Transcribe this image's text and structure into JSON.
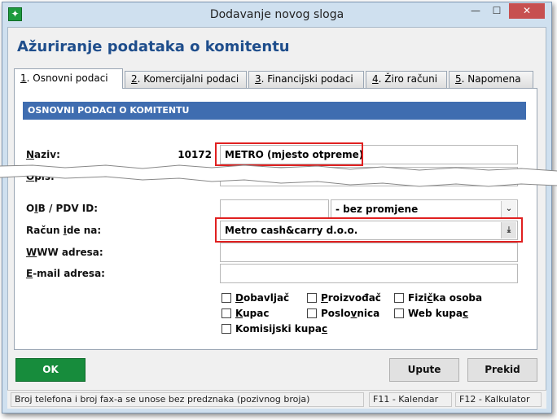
{
  "window": {
    "title": "Dodavanje novog sloga",
    "icon": "app-star-icon",
    "minimize_label": "—",
    "maximize_label": "☐",
    "close_label": "✕"
  },
  "dialog": {
    "heading": "Ažuriranje podataka o komitentu"
  },
  "tabs": [
    {
      "num": "1",
      "label": ". Osnovni podaci"
    },
    {
      "num": "2",
      "label": ". Komercijalni podaci"
    },
    {
      "num": "3",
      "label": ". Financijski podaci"
    },
    {
      "num": "4",
      "label": ". Žiro računi"
    },
    {
      "num": "5",
      "label": ". Napomena"
    }
  ],
  "section": {
    "title": "OSNOVNI PODACI O KOMITENTU"
  },
  "form": {
    "naziv": {
      "label_u": "N",
      "label_rest": "aziv:",
      "code": "10172",
      "value": "METRO (mjesto otpreme)"
    },
    "opis": {
      "label_u": "O",
      "label_rest": "pis:"
    },
    "oib": {
      "label_pre": "O",
      "label_u": "I",
      "label_rest": "B / PDV ID:",
      "value": "",
      "combo_value": "- bez promjene"
    },
    "racun": {
      "label_pre": "Račun ",
      "label_u": "i",
      "label_rest": "de na:",
      "value": "Metro cash&carry d.o.o."
    },
    "www": {
      "label_u": "W",
      "label_rest": "WW adresa:",
      "value": ""
    },
    "email": {
      "label_u": "E",
      "label_rest": "-mail adresa:",
      "value": ""
    }
  },
  "checkboxes": {
    "dobavljac": {
      "label_u": "D",
      "label_rest": "obavljač",
      "checked": false
    },
    "proizvodac": {
      "label_u": "P",
      "label_rest": "roizvođač",
      "checked": false
    },
    "fizicka": {
      "label_pre": "Fizi",
      "label_u": "č",
      "label_rest": "ka osoba",
      "checked": false
    },
    "kupac": {
      "label_u": "K",
      "label_rest": "upac",
      "checked": false
    },
    "poslovnica": {
      "label_pre": "Poslo",
      "label_u": "v",
      "label_rest": "nica",
      "checked": false
    },
    "webkupac": {
      "label_pre": "Web kupa",
      "label_u": "c",
      "label_rest": "",
      "checked": false
    },
    "komisijski": {
      "label_pre": "Komisijski kupa",
      "label_u": "c",
      "label_rest": "",
      "checked": false
    }
  },
  "buttons": {
    "ok": "OK",
    "upute": "Upute",
    "prekid": "Prekid"
  },
  "statusbar": {
    "hint": "Broj telefona i broj fax-a se unose bez predznaka (pozivnog broja)",
    "f11": "F11 - Kalendar",
    "f12": "F12 - Kalkulator"
  },
  "colors": {
    "highlight": "#e02020",
    "ok_button": "#178c3c",
    "section_bar": "#3f6db0",
    "heading": "#1f4e8c"
  }
}
